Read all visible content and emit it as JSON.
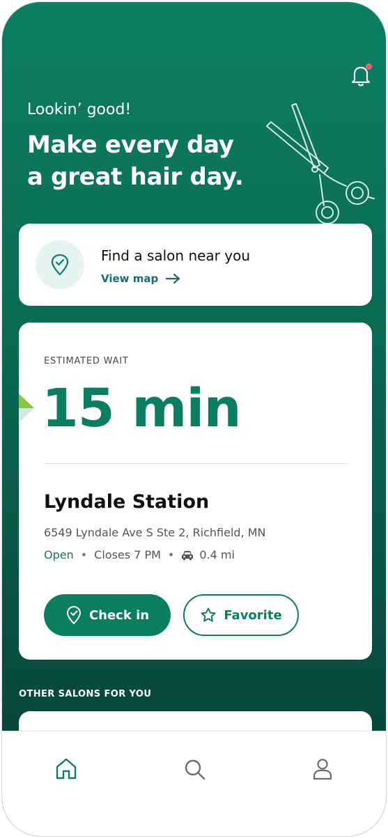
{
  "header": {
    "greeting": "Lookin’ good!",
    "headline_line1": "Make every day",
    "headline_line2": "a great hair day."
  },
  "find_salon": {
    "title": "Find a salon near you",
    "link_label": "View map"
  },
  "wait": {
    "label": "ESTIMATED WAIT",
    "value": "15 min"
  },
  "salon": {
    "name": "Lyndale Station",
    "address": "6549 Lyndale Ave S Ste 2, Richfield, MN",
    "status": "Open",
    "closes": "Closes 7 PM",
    "distance": "0.4 mi",
    "checkin_label": "Check in",
    "favorite_label": "Favorite"
  },
  "other_section": {
    "title": "OTHER SALONS FOR YOU"
  },
  "tabbar": {
    "items": [
      {
        "icon": "home-icon",
        "active": true
      },
      {
        "icon": "search-icon",
        "active": false
      },
      {
        "icon": "profile-icon",
        "active": false
      }
    ]
  },
  "colors": {
    "brand_green": "#0b7d60",
    "header_gradient_top": "#0c7f62",
    "header_gradient_bottom": "#073e35",
    "notification_dot": "#f06464",
    "link_teal": "#1c6a73"
  }
}
